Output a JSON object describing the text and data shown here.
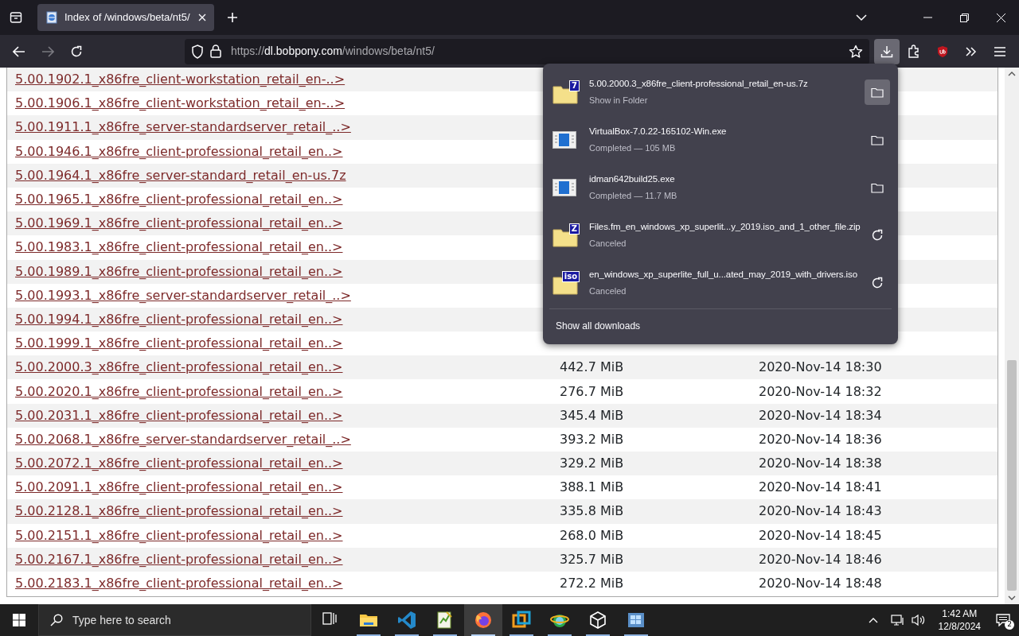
{
  "browser": {
    "tabs": [
      {
        "title": "Index of /windows/beta/nt5/",
        "selected": true
      }
    ],
    "url": {
      "scheme": "https://",
      "host": "dl.bobpony.com",
      "path": "/windows/beta/nt5/"
    },
    "downloads_button": {
      "active": true
    }
  },
  "listing": {
    "rows": [
      {
        "name": "5.00.1902.1_x86fre_client-workstation_retail_en-..>"
      },
      {
        "name": "5.00.1906.1_x86fre_client-workstation_retail_en-..>"
      },
      {
        "name": "5.00.1911.1_x86fre_server-standardserver_retail_..>"
      },
      {
        "name": "5.00.1946.1_x86fre_client-professional_retail_en..>"
      },
      {
        "name": "5.00.1964.1_x86fre_server-standard_retail_en-us.7z"
      },
      {
        "name": "5.00.1965.1_x86fre_client-professional_retail_en..>"
      },
      {
        "name": "5.00.1969.1_x86fre_client-professional_retail_en..>"
      },
      {
        "name": "5.00.1983.1_x86fre_client-professional_retail_en..>"
      },
      {
        "name": "5.00.1989.1_x86fre_client-professional_retail_en..>"
      },
      {
        "name": "5.00.1993.1_x86fre_server-standardserver_retail_..>"
      },
      {
        "name": "5.00.1994.1_x86fre_client-professional_retail_en..>"
      },
      {
        "name": "5.00.1999.1_x86fre_client-professional_retail_en..>"
      },
      {
        "name": "5.00.2000.3_x86fre_client-professional_retail_en..>",
        "size": "442.7 MiB",
        "modified": "2020-Nov-14 18:30"
      },
      {
        "name": "5.00.2020.1_x86fre_client-professional_retail_en..>",
        "size": "276.7 MiB",
        "modified": "2020-Nov-14 18:32"
      },
      {
        "name": "5.00.2031.1_x86fre_client-professional_retail_en..>",
        "size": "345.4 MiB",
        "modified": "2020-Nov-14 18:34"
      },
      {
        "name": "5.00.2068.1_x86fre_server-standardserver_retail_..>",
        "size": "393.2 MiB",
        "modified": "2020-Nov-14 18:36"
      },
      {
        "name": "5.00.2072.1_x86fre_client-professional_retail_en..>",
        "size": "329.2 MiB",
        "modified": "2020-Nov-14 18:38"
      },
      {
        "name": "5.00.2091.1_x86fre_client-professional_retail_en..>",
        "size": "388.1 MiB",
        "modified": "2020-Nov-14 18:41"
      },
      {
        "name": "5.00.2128.1_x86fre_client-professional_retail_en..>",
        "size": "335.8 MiB",
        "modified": "2020-Nov-14 18:43"
      },
      {
        "name": "5.00.2151.1_x86fre_client-professional_retail_en..>",
        "size": "268.0 MiB",
        "modified": "2020-Nov-14 18:45"
      },
      {
        "name": "5.00.2167.1_x86fre_client-professional_retail_en..>",
        "size": "325.7 MiB",
        "modified": "2020-Nov-14 18:46"
      },
      {
        "name": "5.00.2183.1_x86fre_client-professional_retail_en..>",
        "size": "272.2 MiB",
        "modified": "2020-Nov-14 18:48"
      }
    ]
  },
  "downloads_panel": {
    "items": [
      {
        "kind": "archive",
        "badge": "7",
        "name": "5.00.2000.3_x86fre_client-professional_retail_en-us.7z",
        "status": "Show in Folder",
        "retry": false,
        "hovered": true
      },
      {
        "kind": "exe",
        "name": "VirtualBox-7.0.22-165102-Win.exe",
        "status": "Completed — 105 MB",
        "retry": false,
        "hovered": false
      },
      {
        "kind": "exe",
        "name": "idman642build25.exe",
        "status": "Completed — 11.7 MB",
        "retry": false,
        "hovered": false
      },
      {
        "kind": "archive",
        "badge": "Z",
        "name": "Files.fm_en_windows_xp_superlit...y_2019.iso_and_1_other_file.zip",
        "status": "Canceled",
        "retry": true,
        "hovered": false
      },
      {
        "kind": "archive",
        "badge": "iso",
        "name": "en_windows_xp_superlite_full_u...ated_may_2019_with_drivers.iso",
        "status": "Canceled",
        "retry": true,
        "hovered": false
      }
    ],
    "footer": "Show all downloads"
  },
  "taskbar": {
    "search_placeholder": "Type here to search",
    "apps": [
      {
        "kind": "taskview",
        "selected": false
      },
      {
        "kind": "explorer",
        "selected": false
      },
      {
        "kind": "code",
        "selected": false
      },
      {
        "kind": "notepad",
        "selected": false
      },
      {
        "kind": "firefox",
        "selected": true
      },
      {
        "kind": "squares",
        "selected": false
      },
      {
        "kind": "globe",
        "selected": false
      },
      {
        "kind": "cube",
        "selected": false
      },
      {
        "kind": "xp",
        "selected": false
      }
    ],
    "time": "1:42 AM",
    "date": "12/8/2024",
    "notifications": "2"
  }
}
